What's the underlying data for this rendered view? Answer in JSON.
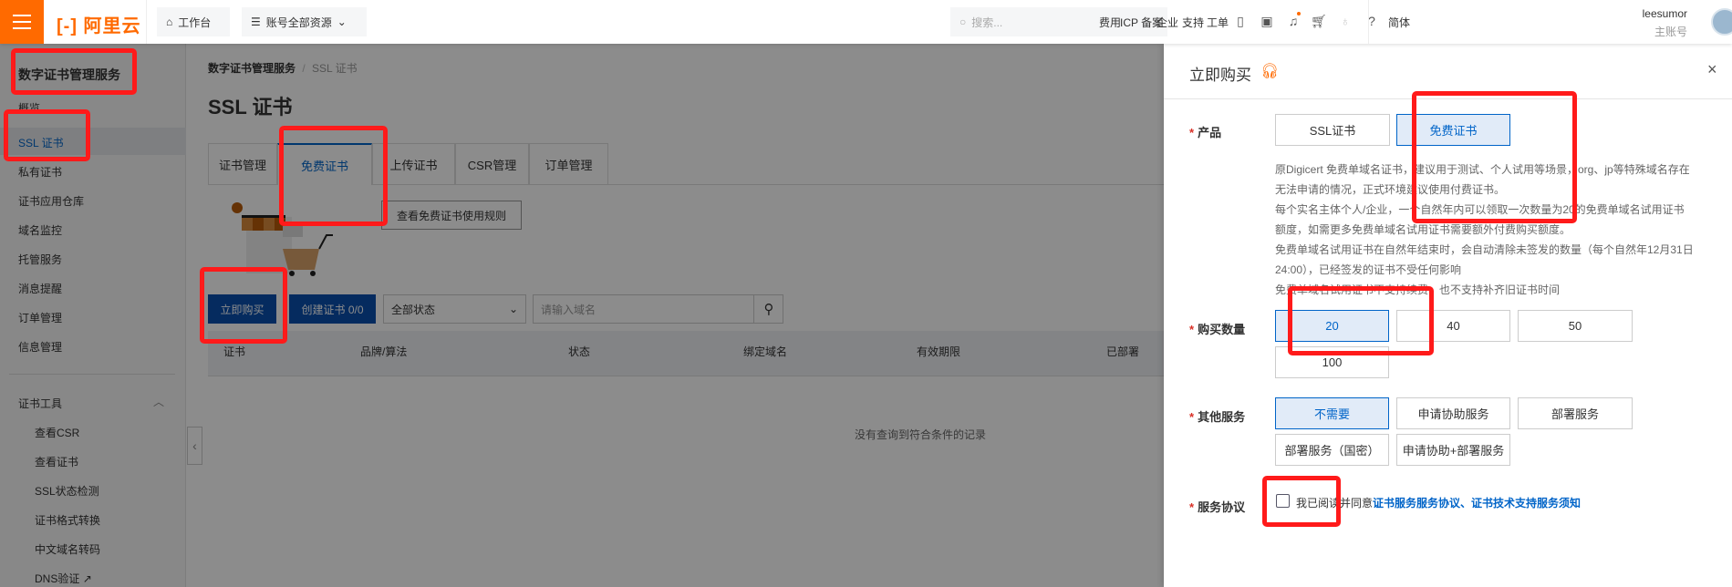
{
  "topbar": {
    "logo": "阿里云",
    "workbench": "工作台",
    "resources": "账号全部资源",
    "search_placeholder": "搜索...",
    "nav": [
      "费用",
      "ICP 备案",
      "企业",
      "支持",
      "工单"
    ],
    "lang": "简体",
    "username": "leesumor",
    "account_type": "主账号"
  },
  "sidebar": {
    "title": "数字证书管理服务",
    "items": [
      "概览",
      "SSL 证书",
      "私有证书",
      "证书应用仓库",
      "域名监控",
      "托管服务",
      "消息提醒",
      "订单管理",
      "信息管理"
    ],
    "tools_group": "证书工具",
    "tools": [
      "查看CSR",
      "查看证书",
      "SSL状态检测",
      "证书格式转换",
      "中文域名转码",
      "DNS验证"
    ]
  },
  "main": {
    "breadcrumb": [
      "数字证书管理服务",
      "/",
      "SSL 证书"
    ],
    "title": "SSL 证书",
    "tabs": [
      "证书管理",
      "免费证书",
      "上传证书",
      "CSR管理",
      "订单管理"
    ],
    "rules_button": "查看免费证书使用规则",
    "buy_button": "立即购买",
    "create_button": "创建证书 0/0",
    "status_select": "全部状态",
    "domain_placeholder": "请输入域名",
    "columns": [
      "证书",
      "品牌/算法",
      "状态",
      "绑定域名",
      "有效期限",
      "已部署"
    ],
    "empty": "没有查询到符合条件的记录"
  },
  "drawer": {
    "title": "立即购买",
    "product_label": "产品",
    "products": [
      "SSL证书",
      "免费证书"
    ],
    "description": [
      "原Digicert 免费单域名证书，建议用于测试、个人试用等场景，org、jp等特殊域名存在无法申请的情况，正式环境建议使用付费证书。",
      "每个实名主体个人/企业，一个自然年内可以领取一次数量为20的免费单域名试用证书额度，如需更多免费单域名试用证书需要额外付费购买额度。",
      "免费单域名试用证书在自然年结束时，会自动清除未签发的数量（每个自然年12月31日24:00），已经签发的证书不受任何影响",
      "免费单域名试用证书不支持续费，也不支持补齐旧证书时间"
    ],
    "quantity_label": "购买数量",
    "quantities": [
      "20",
      "40",
      "50",
      "100"
    ],
    "service_label": "其他服务",
    "services": [
      "不需要",
      "申请协助服务",
      "部署服务",
      "部署服务（国密）",
      "申请协助+部署服务"
    ],
    "agreement_label": "服务协议",
    "agreement_text": "我已阅读并同意",
    "agreement_links": "证书服务服务协议、证书技术支持服务须知",
    "required_mark": "*"
  },
  "colors": {
    "brand": "#ff6a00",
    "primary": "#0064c8",
    "annotation": "#ff1a1a"
  }
}
